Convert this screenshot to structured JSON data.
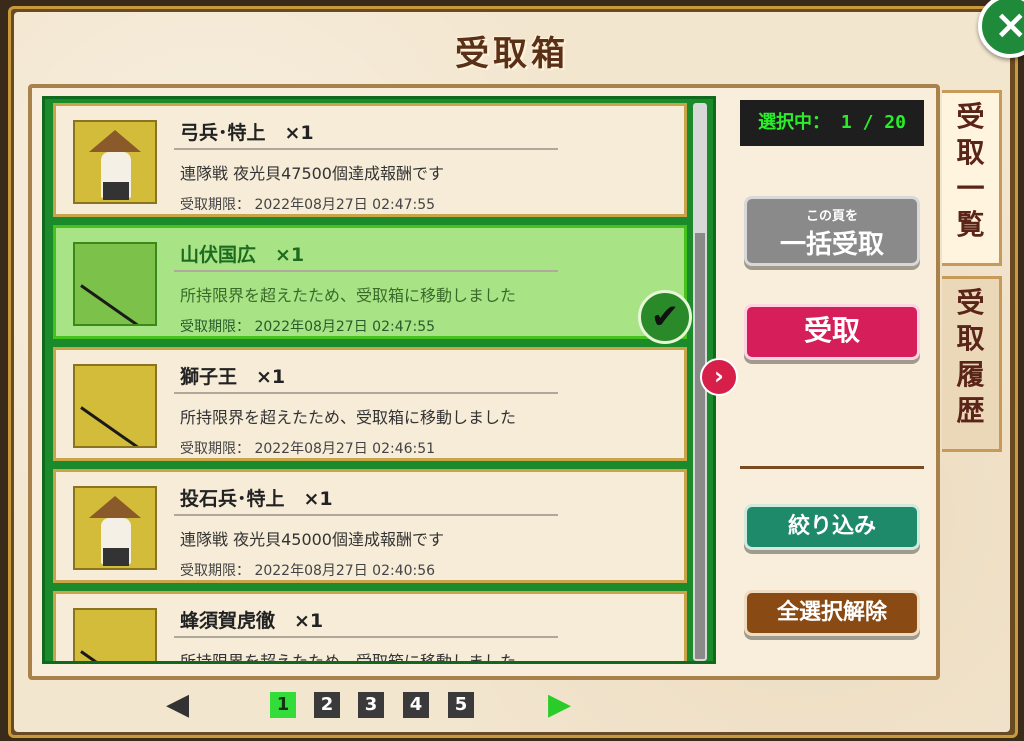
{
  "header": {
    "title": "受取箱",
    "close_icon": "×"
  },
  "items": [
    {
      "name": "弓兵･特上　×1",
      "desc": "連隊戦 夜光貝47500個達成報酬です",
      "deadline": "受取期限： 2022年08月27日 02:47:55",
      "icon": "archer-icon",
      "selected": false
    },
    {
      "name": "山伏国広　×1",
      "desc": "所持限界を超えたため、受取箱に移動しました",
      "deadline": "受取期限： 2022年08月27日 02:47:55",
      "icon": "sword-icon",
      "selected": true
    },
    {
      "name": "獅子王　×1",
      "desc": "所持限界を超えたため、受取箱に移動しました",
      "deadline": "受取期限： 2022年08月27日 02:46:51",
      "icon": "sword-icon",
      "selected": false
    },
    {
      "name": "投石兵･特上　×1",
      "desc": "連隊戦 夜光貝45000個達成報酬です",
      "deadline": "受取期限： 2022年08月27日 02:40:56",
      "icon": "stone-thrower-icon",
      "selected": false
    },
    {
      "name": "蜂須賀虎徹　×1",
      "desc": "所持限界を超えたため、受取箱に移動しました",
      "deadline": "",
      "icon": "sword-icon",
      "selected": false
    }
  ],
  "check_mark": "✔",
  "next_arrow": "›",
  "counter": "選択中： 1 / 20",
  "buttons": {
    "bulk_small": "この頁を",
    "bulk_big": "一括受取",
    "receive": "受取",
    "filter": "絞り込み",
    "deselect_all": "全選択解除"
  },
  "tabs": {
    "list": "受取一覧",
    "history": "受取履歴"
  },
  "pager": {
    "first": "◀",
    "pages": [
      "1",
      "2",
      "3",
      "4",
      "5"
    ],
    "current": "1",
    "last": "▶"
  }
}
